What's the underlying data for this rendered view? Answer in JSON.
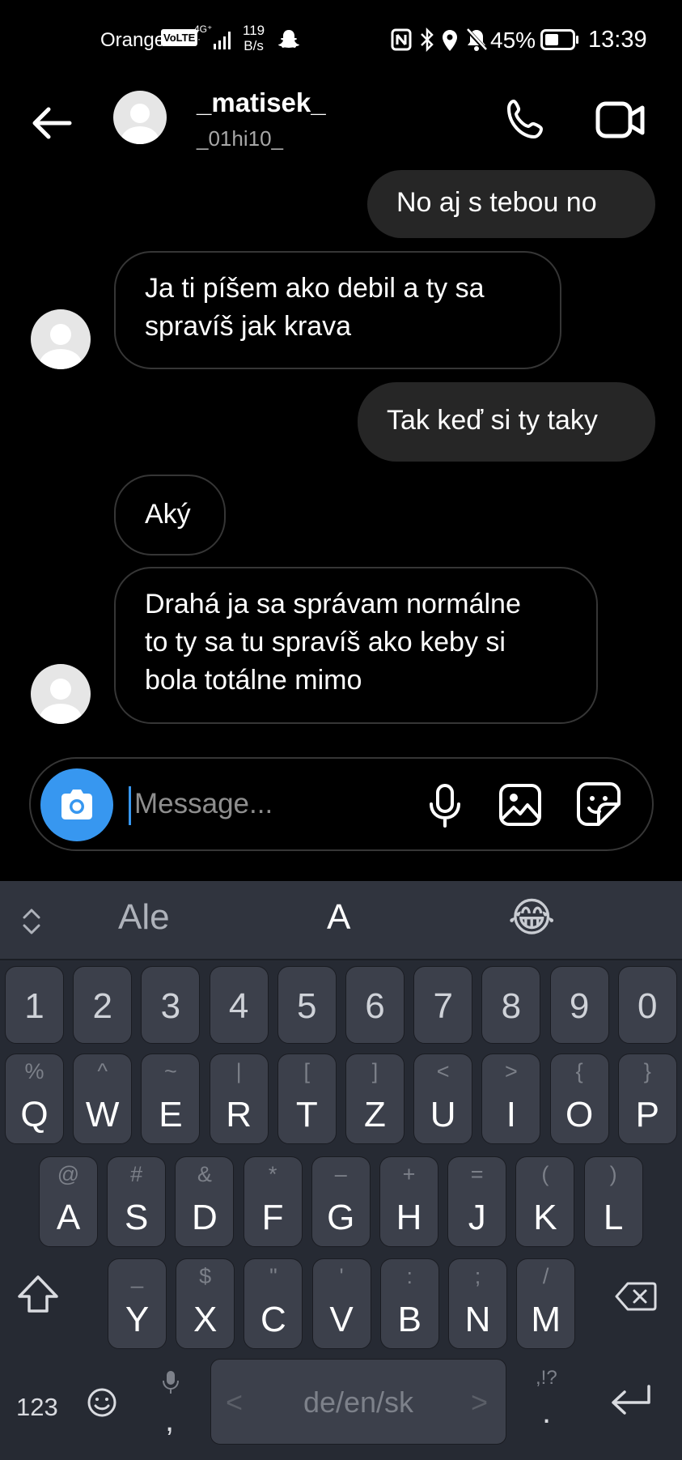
{
  "status_bar": {
    "carrier": "Orange",
    "volte": "VoLTE",
    "network": "4G⁺",
    "network_sub": "¹·",
    "speed_value": "119",
    "speed_unit": "B/s",
    "battery_percent": "45%",
    "time": "13:39"
  },
  "header": {
    "name": "_matisek_",
    "username": "_01hi10_"
  },
  "messages": [
    {
      "direction": "out",
      "text": "No aj s tebou no"
    },
    {
      "direction": "in",
      "lines": [
        "Ja ti píšem ako debil a ty sa",
        "spravíš jak krava"
      ]
    },
    {
      "direction": "out",
      "text": "Tak keď si ty taky"
    },
    {
      "direction": "in",
      "text": "Aký"
    },
    {
      "direction": "in",
      "lines": [
        "Drahá ja sa správam normálne",
        "to ty sa tu spravíš ako keby si",
        "bola totálne mimo"
      ]
    }
  ],
  "composer": {
    "placeholder": "Message..."
  },
  "keyboard": {
    "suggestions": [
      "Ale",
      "A",
      "😂"
    ],
    "numbers": [
      "1",
      "2",
      "3",
      "4",
      "5",
      "6",
      "7",
      "8",
      "9",
      "0"
    ],
    "row1": [
      {
        "main": "Q",
        "alt": "%"
      },
      {
        "main": "W",
        "alt": "^"
      },
      {
        "main": "E",
        "alt": "~"
      },
      {
        "main": "R",
        "alt": "|"
      },
      {
        "main": "T",
        "alt": "["
      },
      {
        "main": "Z",
        "alt": "]"
      },
      {
        "main": "U",
        "alt": "<"
      },
      {
        "main": "I",
        "alt": ">"
      },
      {
        "main": "O",
        "alt": "{"
      },
      {
        "main": "P",
        "alt": "}"
      }
    ],
    "row2": [
      {
        "main": "A",
        "alt": "@"
      },
      {
        "main": "S",
        "alt": "#"
      },
      {
        "main": "D",
        "alt": "&"
      },
      {
        "main": "F",
        "alt": "*"
      },
      {
        "main": "G",
        "alt": "–"
      },
      {
        "main": "H",
        "alt": "+"
      },
      {
        "main": "J",
        "alt": "="
      },
      {
        "main": "K",
        "alt": "("
      },
      {
        "main": "L",
        "alt": ")"
      }
    ],
    "row3": [
      {
        "main": "Y",
        "alt": "_"
      },
      {
        "main": "X",
        "alt": "$"
      },
      {
        "main": "C",
        "alt": "\""
      },
      {
        "main": "V",
        "alt": "'"
      },
      {
        "main": "B",
        "alt": ":"
      },
      {
        "main": "N",
        "alt": ";"
      },
      {
        "main": "M",
        "alt": "/"
      }
    ],
    "symbols_label": "123",
    "comma": ",",
    "space_label": "de/en/sk",
    "space_left": "<",
    "space_right": ">",
    "punct_alt": ",!?",
    "period": "."
  }
}
